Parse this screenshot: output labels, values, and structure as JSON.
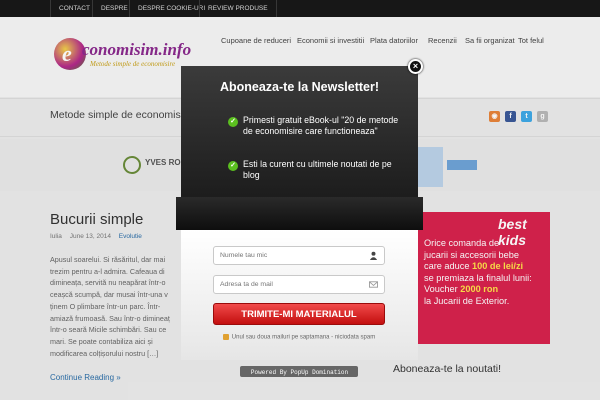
{
  "topnav": {
    "items": [
      "CONTACT",
      "DESPRE",
      "DESPRE COOKIE-URI",
      "REVIEW PRODUSE"
    ]
  },
  "logo": {
    "mark": "e",
    "word": "conomisim.info",
    "tagline": "Metode simple de economisire"
  },
  "mainnav": {
    "items": [
      "Cupoane de reduceri",
      "Economii si investitii",
      "Plata datoriilor",
      "Recenzii",
      "Sa fii organizat",
      "Tot felul"
    ]
  },
  "tagline": "Metode simple de economisi",
  "social": [
    {
      "icon": "rss-icon",
      "color": "#e8843a",
      "glyph": "◉"
    },
    {
      "icon": "facebook-icon",
      "color": "#3b5998",
      "glyph": "f"
    },
    {
      "icon": "twitter-icon",
      "color": "#3fa9e6",
      "glyph": "t"
    },
    {
      "icon": "googleplus-icon",
      "color": "#c0c0c0",
      "glyph": "g"
    }
  ],
  "banner": {
    "yves_text": "YVES RO"
  },
  "post": {
    "title": "Bucurii simple",
    "author": "Iulia",
    "date": "June 13, 2014",
    "category": "Evolutie",
    "body_left": "Apusul soarelui. Si răsăritul, dar mai trezim pentru a-l admira. Cafeaua di dimineața, servită nu neapărat într-o ceașcă scumpă, dar musai într-una v ținem O plimbare într-un parc. Într- amiază frumoasă. Sau într-o dimineaț într-o seară Micile schimbări. Sau ce mari. Se poate contabiliza aici și modificarea colțișorului nostru […]",
    "continue": "Continue Reading »"
  },
  "sidebar": {
    "ad_brand": "best kids",
    "ad_text_1": "Orice comanda de",
    "ad_text_2": "jucarii si accesorii bebe",
    "ad_text_3": "care aduce",
    "ad_text_hl1": "100 de lei/zi",
    "ad_text_4": "se premiaza la finalul lunii:",
    "ad_text_5": "Voucher",
    "ad_text_hl2": "2000 ron",
    "ad_text_6": "la Jucarii de Exterior.",
    "heading": "Aboneaza-te la noutati!"
  },
  "popup": {
    "title": "Aboneaza-te la Newsletter!",
    "bullet_1": "Primesti gratuit eBook-ul \"20 de metode de economisire care functioneaza\"",
    "bullet_2": "Esti la curent cu ultimele noutati de pe blog",
    "name_placeholder": "Numele tau mic",
    "email_placeholder": "Adresa ta de mail",
    "submit_label": "TRIMITE-MI MATERIALUL",
    "spam_note": "Unul sau doua mailuri pe saptamana - niciodata spam",
    "powered_by": "Powered By PopUp Domination",
    "close_glyph": "×"
  }
}
